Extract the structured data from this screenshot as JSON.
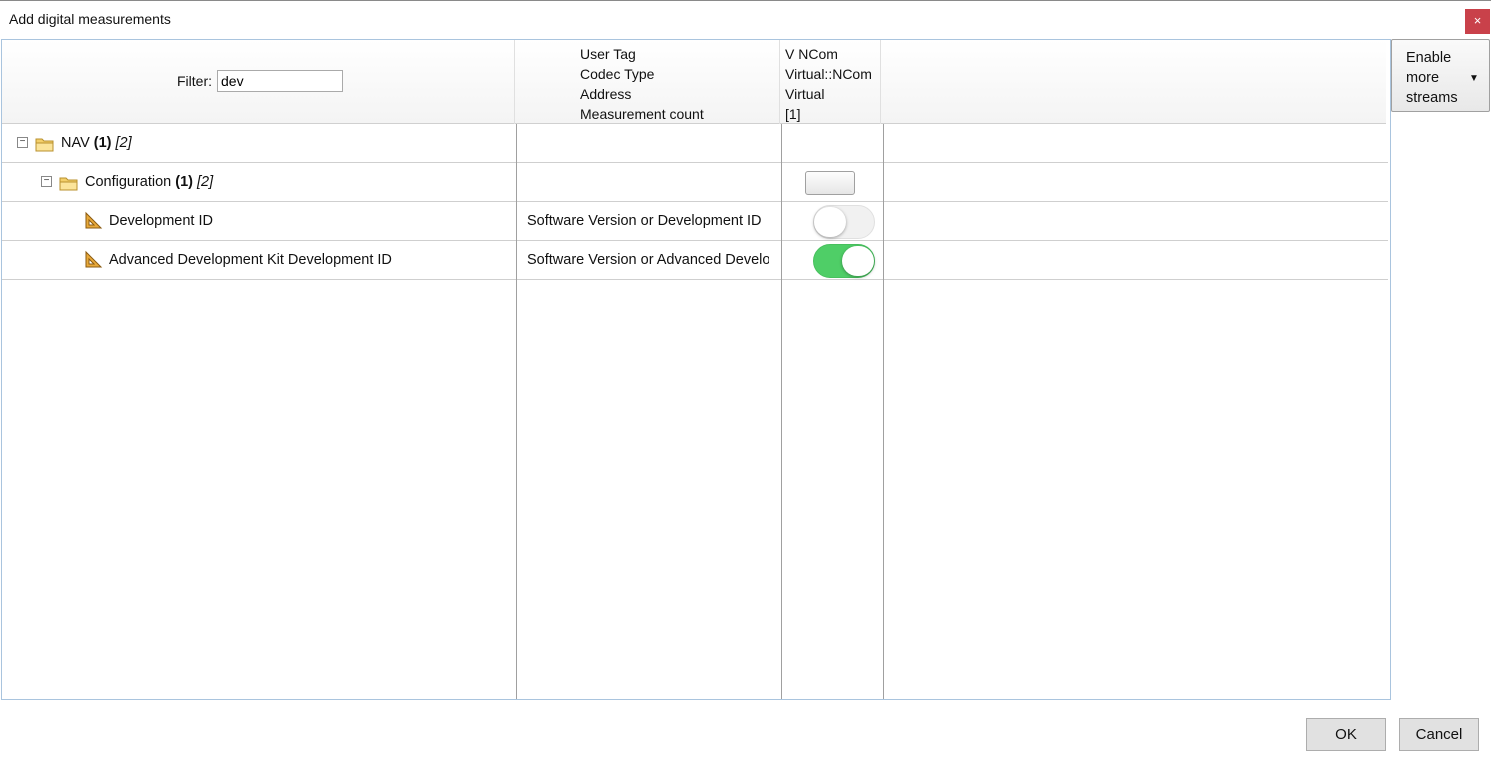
{
  "window": {
    "title": "Add digital measurements",
    "close_label": "×",
    "close_color": "#c9414a"
  },
  "filter": {
    "label": "Filter:",
    "value": "dev"
  },
  "header": {
    "properties": [
      "User Tag",
      "Codec Type",
      "Address",
      "Measurement count"
    ],
    "stream_values": [
      "V NCom",
      "Virtual::NCom",
      "Virtual",
      "[1]"
    ]
  },
  "tree": {
    "nav": {
      "name": "NAV",
      "count": "(1)",
      "total": "[2]",
      "expander": "−"
    },
    "configuration": {
      "name": "Configuration",
      "count": "(1)",
      "total": "[2]",
      "expander": "−"
    },
    "items": [
      {
        "name": "Development ID",
        "description": "Software Version or Development ID",
        "enabled": false
      },
      {
        "name": "Advanced Development Kit Development ID",
        "description": "Software Version or Advanced Development Kit Development ID",
        "enabled": true
      }
    ]
  },
  "streams_button": {
    "label": "Enable more streams",
    "icon": "caret-down-icon",
    "arrow": "▼"
  },
  "footer": {
    "ok_label": "OK",
    "cancel_label": "Cancel"
  },
  "colors": {
    "toggle_on": "#4fce67",
    "grid_border": "#a9c4de"
  }
}
